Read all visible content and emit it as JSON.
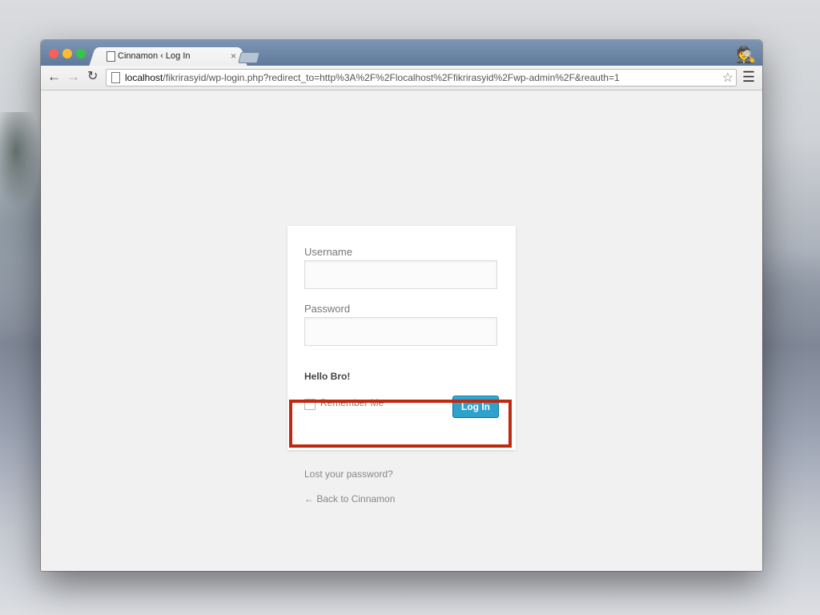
{
  "browser": {
    "tab_title": "Cinnamon ‹ Log In",
    "tab_close": "×",
    "url_host": "localhost",
    "url_path": "/fikrirasyid/wp-login.php?redirect_to=http%3A%2F%2Flocalhost%2Ffikrirasyid%2Fwp-admin%2F&reauth=1"
  },
  "icons": {
    "back": "←",
    "forward": "→",
    "reload": "↻",
    "star": "☆",
    "menu": "☰",
    "incognito": "🕵"
  },
  "login": {
    "username_label": "Username",
    "username_value": "",
    "password_label": "Password",
    "password_value": "",
    "message": "Hello Bro!",
    "remember_label": "Remember Me",
    "login_button": "Log In",
    "lost_password": "Lost your password?",
    "back_link": "← Back to Cinnamon"
  },
  "colors": {
    "login_button": "#2ea2cc",
    "highlight": "#c0290f",
    "titlebar": "#6b84a5"
  }
}
